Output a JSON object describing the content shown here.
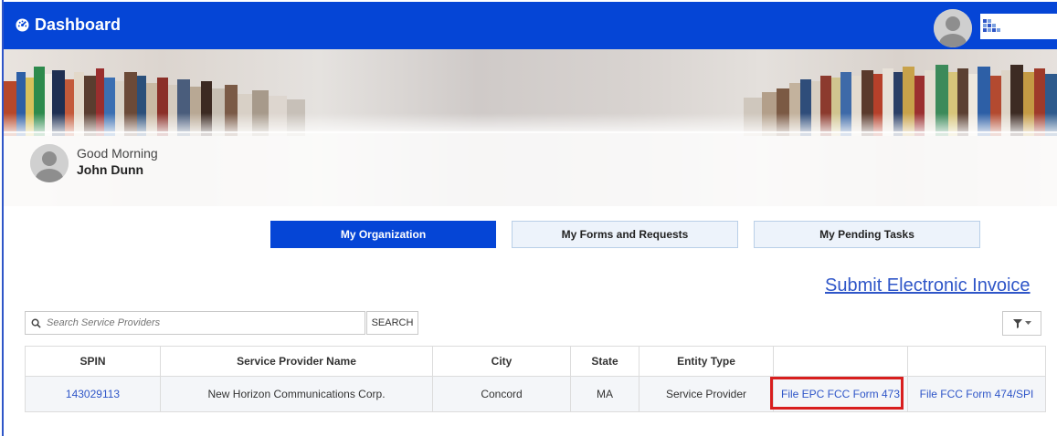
{
  "header": {
    "title": "Dashboard",
    "logo_text": "Universal Service Administrative Co."
  },
  "greeting": {
    "salutation": "Good Morning",
    "name": "John Dunn"
  },
  "tabs": [
    {
      "label": "My Organization",
      "active": true
    },
    {
      "label": "My Forms and Requests",
      "active": false
    },
    {
      "label": "My Pending Tasks",
      "active": false
    }
  ],
  "submit_link": "Submit Electronic Invoice",
  "search": {
    "placeholder": "Search Service Providers",
    "button_label": "SEARCH"
  },
  "table": {
    "columns": [
      "SPIN",
      "Service Provider Name",
      "City",
      "State",
      "Entity Type",
      "",
      ""
    ],
    "rows": [
      {
        "spin": "143029113",
        "name": "New Horizon Communications Corp.",
        "city": "Concord",
        "state": "MA",
        "entity_type": "Service Provider",
        "action1": "File EPC FCC Form 473",
        "action2": "File FCC Form 474/SPI"
      }
    ]
  },
  "colors": {
    "primary": "#0545d6",
    "link": "#2f56c8",
    "highlight": "#d81e1e"
  }
}
